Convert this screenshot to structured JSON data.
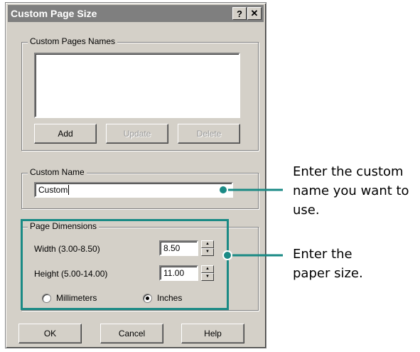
{
  "dialog": {
    "title": "Custom Page Size",
    "help_btn": "?",
    "close_btn": "✕"
  },
  "custom_pages": {
    "legend": "Custom Pages Names",
    "add_label": "Add",
    "update_label": "Update",
    "delete_label": "Delete"
  },
  "custom_name": {
    "legend": "Custom Name",
    "value": "Custom"
  },
  "page_dimensions": {
    "legend": "Page Dimensions",
    "width_label": "Width (3.00-8.50)",
    "width_value": "8.50",
    "height_label": "Height (5.00-14.00)",
    "height_value": "11.00",
    "unit_mm_label": "Millimeters",
    "unit_in_label": "Inches",
    "selected_unit": "Inches"
  },
  "footer": {
    "ok_label": "OK",
    "cancel_label": "Cancel",
    "help_label": "Help"
  },
  "callouts": {
    "name_line1": "Enter the custom",
    "name_line2": "name you want to",
    "name_line3": "use.",
    "size_line1": "Enter the",
    "size_line2": "paper size."
  },
  "colors": {
    "callout": "#1a8a85",
    "titlebar": "#7f7f7f",
    "dialog_bg": "#d4d0c8"
  }
}
